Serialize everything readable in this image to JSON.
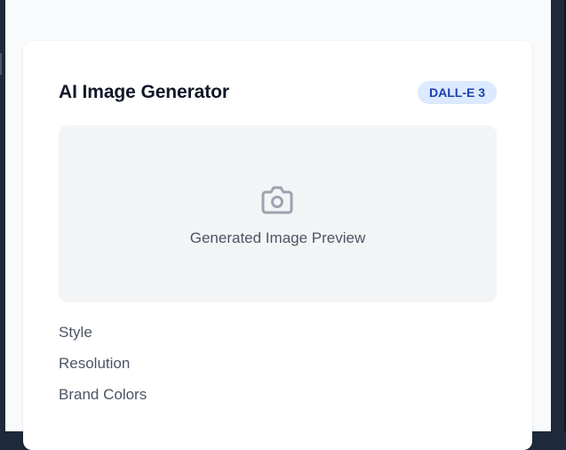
{
  "card": {
    "title": "AI Image Generator",
    "badge": "DALL-E 3"
  },
  "preview": {
    "icon": "camera-icon",
    "label": "Generated Image Preview"
  },
  "options": [
    {
      "label": "Style"
    },
    {
      "label": "Resolution"
    },
    {
      "label": "Brand Colors"
    }
  ],
  "colors": {
    "badge_bg": "#dbeafe",
    "badge_text": "#1e40af",
    "preview_bg": "#f3f4f6",
    "icon": "#9ca3af"
  }
}
